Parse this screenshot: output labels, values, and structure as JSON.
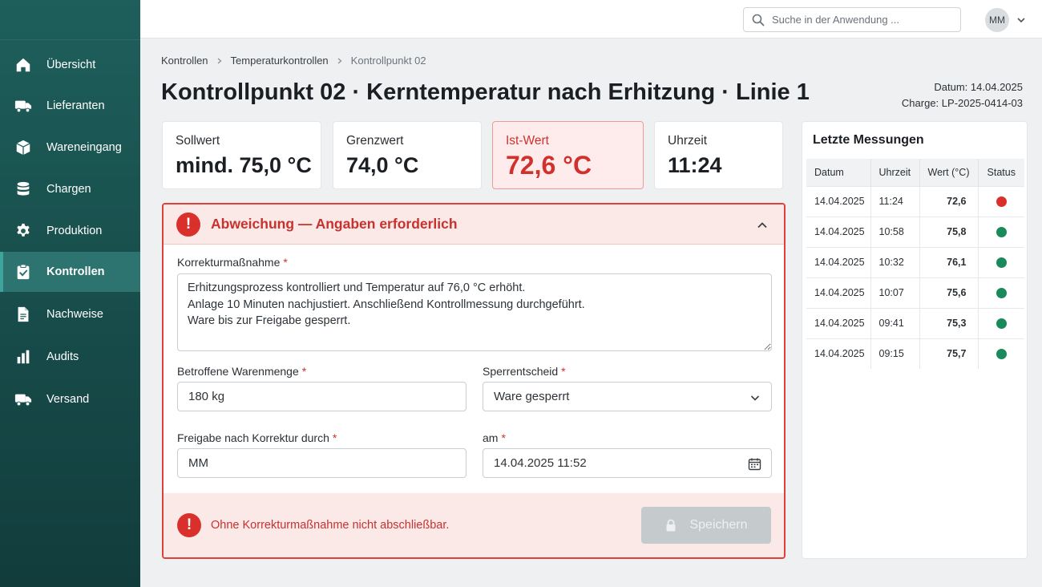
{
  "colors": {
    "sidebar": "#1e5f5b",
    "accent": "#3fa39b",
    "error": "#d9302c",
    "ok": "#1a8a5c"
  },
  "sidebar": {
    "items": [
      {
        "label": "Übersicht",
        "icon": "home-icon",
        "active": false
      },
      {
        "label": "Lieferanten",
        "icon": "truck-icon",
        "active": false
      },
      {
        "label": "Wareneingang",
        "icon": "box-icon",
        "active": false
      },
      {
        "label": "Chargen",
        "icon": "database-icon",
        "active": false
      },
      {
        "label": "Produktion",
        "icon": "gear-icon",
        "active": false
      },
      {
        "label": "Kontrollen",
        "icon": "clipboard-check-icon",
        "active": true
      },
      {
        "label": "Nachweise",
        "icon": "document-icon",
        "active": false
      },
      {
        "label": "Audits",
        "icon": "bar-chart-icon",
        "active": false
      },
      {
        "label": "Versand",
        "icon": "truck-icon",
        "active": false
      }
    ]
  },
  "topbar": {
    "search_placeholder": "Suche in der Anwendung ...",
    "avatar": "MM"
  },
  "breadcrumb": [
    "Kontrollen",
    "Temperaturkontrollen",
    "Kontrollpunkt 02"
  ],
  "page": {
    "title": "Kontrollpunkt 02 · Kerntemperatur nach Erhitzung · Linie 1",
    "datum_label": "Datum:",
    "datum": "14.04.2025",
    "charge_label": "Charge:",
    "charge": "LP-2025-0414-03"
  },
  "kpis": [
    {
      "label": "Sollwert",
      "value": "mind. 75,0 °C",
      "alert": false
    },
    {
      "label": "Grenzwert",
      "value": "74,0 °C",
      "alert": false
    },
    {
      "label": "Ist-Wert",
      "value": "72,6 °C",
      "alert": true
    },
    {
      "label": "Uhrzeit",
      "value": "11:24",
      "alert": false
    }
  ],
  "deviation": {
    "title": "Abweichung — Angaben erforderlich",
    "korrektur_label": "Korrekturmaßnahme",
    "korrektur_value": "Erhitzungsprozess kontrolliert und Temperatur auf 76,0 °C erhöht.\nAnlage 10 Minuten nachjustiert. Anschließend Kontrollmessung durchgeführt.\nWare bis zur Freigabe gesperrt.",
    "menge_label": "Betroffene Warenmenge",
    "menge_value": "180 kg",
    "sperr_label": "Sperrentscheid",
    "sperr_value": "Ware gesperrt",
    "freigabe_label": "Freigabe nach Korrektur durch",
    "freigabe_value": "MM",
    "am_label": "am",
    "am_value": "14.04.2025 11:52",
    "required_mark": "*",
    "footer_message": "Ohne Korrekturmaßnahme nicht abschließbar.",
    "save_label": "Speichern"
  },
  "measurements": {
    "title": "Letzte Messungen",
    "headers": [
      "Datum",
      "Uhrzeit",
      "Wert (°C)",
      "Status"
    ],
    "rows": [
      {
        "datum": "14.04.2025",
        "uhrzeit": "11:24",
        "wert": "72,6",
        "status": "error"
      },
      {
        "datum": "14.04.2025",
        "uhrzeit": "10:58",
        "wert": "75,8",
        "status": "ok"
      },
      {
        "datum": "14.04.2025",
        "uhrzeit": "10:32",
        "wert": "76,1",
        "status": "ok"
      },
      {
        "datum": "14.04.2025",
        "uhrzeit": "10:07",
        "wert": "75,6",
        "status": "ok"
      },
      {
        "datum": "14.04.2025",
        "uhrzeit": "09:41",
        "wert": "75,3",
        "status": "ok"
      },
      {
        "datum": "14.04.2025",
        "uhrzeit": "09:15",
        "wert": "75,7",
        "status": "ok"
      }
    ]
  }
}
